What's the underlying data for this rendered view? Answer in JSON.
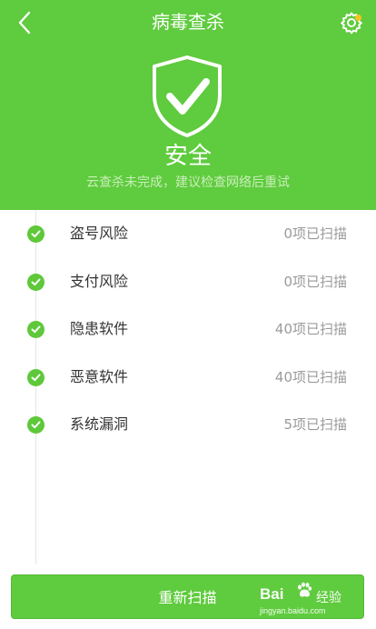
{
  "header": {
    "title": "病毒查杀",
    "back_icon": "chevron-left-icon",
    "settings_icon": "gear-icon",
    "settings_badge_color": "#f7c41f",
    "background_color": "#5fcb3e"
  },
  "status": {
    "icon": "shield-check-icon",
    "title": "安全",
    "subtitle": "云查杀未完成，建议检查网络后重试"
  },
  "scan_items": [
    {
      "label": "盗号风险",
      "count": "0项已扫描",
      "icon": "check-circle-icon"
    },
    {
      "label": "支付风险",
      "count": "0项已扫描",
      "icon": "check-circle-icon"
    },
    {
      "label": "隐患软件",
      "count": "40项已扫描",
      "icon": "check-circle-icon"
    },
    {
      "label": "恶意软件",
      "count": "40项已扫描",
      "icon": "check-circle-icon"
    },
    {
      "label": "系统漏洞",
      "count": "5项已扫描",
      "icon": "check-circle-icon"
    }
  ],
  "actions": {
    "rescan_label": "重新扫描"
  },
  "watermark": {
    "brand": "Bai  经验",
    "product": "经验",
    "url": "jingyan.baidu.com"
  }
}
